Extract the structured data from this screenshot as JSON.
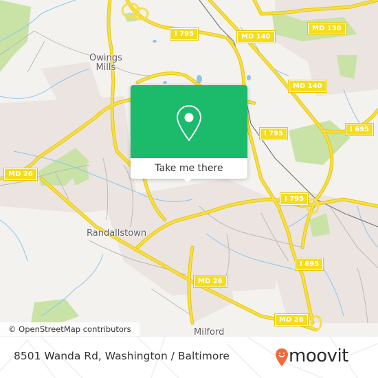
{
  "map": {
    "place_labels": [
      {
        "id": "owings-mills",
        "text": "Owings\nMills"
      },
      {
        "id": "randallstown",
        "text": "Randallstown"
      },
      {
        "id": "milford",
        "text": "Milford"
      }
    ],
    "road_shields": [
      {
        "id": "i795-top",
        "text": "I 795"
      },
      {
        "id": "md140-top",
        "text": "MD 140"
      },
      {
        "id": "md130",
        "text": "MD 130"
      },
      {
        "id": "md140-right",
        "text": "MD 140"
      },
      {
        "id": "i795-mid",
        "text": "I 795"
      },
      {
        "id": "i695-top",
        "text": "I 695"
      },
      {
        "id": "md26-left",
        "text": "MD 26"
      },
      {
        "id": "i795-lower",
        "text": "I 795"
      },
      {
        "id": "i695-lower",
        "text": "I 695"
      },
      {
        "id": "md26-mid",
        "text": "MD 26"
      },
      {
        "id": "md26-lower",
        "text": "MD 26"
      }
    ],
    "colors": {
      "land": "#f3f2ef",
      "urban": "#ebe4e0",
      "park": "#c8e3a5",
      "water": "#8ac6ee",
      "highway": "#f7de4e",
      "minor_road": "#bdb9b5"
    }
  },
  "popup": {
    "cta_label": "Take me there",
    "icon": "location-pin-icon",
    "accent_color": "#1cba6b"
  },
  "attribution": "© OpenStreetMap contributors",
  "footer": {
    "address": "8501 Wanda Rd, Washington / Baltimore",
    "brand": "moovit",
    "brand_color": "#f26a3a"
  }
}
